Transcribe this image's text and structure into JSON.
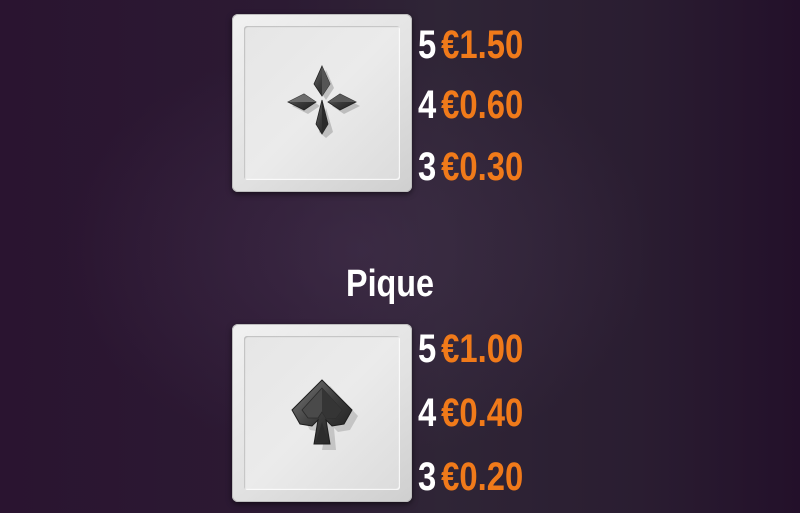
{
  "symbols": [
    {
      "name": "",
      "icon": "club-icon",
      "payouts": [
        {
          "count": "5",
          "amount": "€1.50"
        },
        {
          "count": "4",
          "amount": "€0.60"
        },
        {
          "count": "3",
          "amount": "€0.30"
        }
      ]
    },
    {
      "name": "Pique",
      "icon": "spade-icon",
      "payouts": [
        {
          "count": "5",
          "amount": "€1.00"
        },
        {
          "count": "4",
          "amount": "€0.40"
        },
        {
          "count": "3",
          "amount": "€0.20"
        }
      ]
    }
  ],
  "colors": {
    "amount": "#f07a1a",
    "count": "#ffffff",
    "title": "#ffffff"
  }
}
